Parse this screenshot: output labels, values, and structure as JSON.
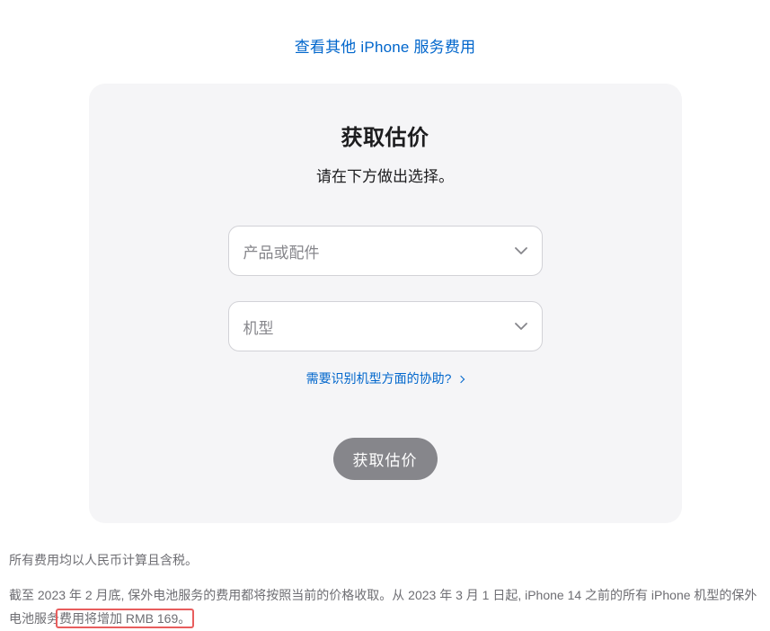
{
  "top_link": {
    "label": "查看其他 iPhone 服务费用"
  },
  "card": {
    "title": "获取估价",
    "subtitle": "请在下方做出选择。",
    "select_product_placeholder": "产品或配件",
    "select_model_placeholder": "机型",
    "help_link_label": "需要识别机型方面的协助?",
    "button_label": "获取估价"
  },
  "footnotes": {
    "line1": "所有费用均以人民币计算且含税。",
    "line2_pre": "截至 2023 年 2 月底, 保外电池服务的费用都将按照当前的价格收取。从 2023 年 3 月 1 日起, iPhone 14 之前的所有 iPhone 机型的保外电池服务",
    "line2_highlight": "费用将增加 RMB 169。"
  }
}
